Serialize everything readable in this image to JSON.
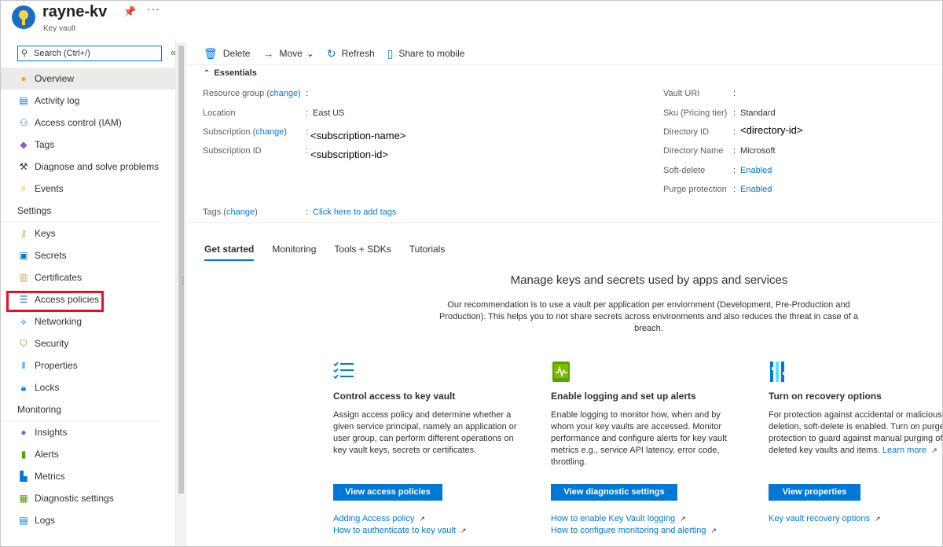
{
  "header": {
    "title": "rayne-kv",
    "subtitle": "Key vault"
  },
  "sidebar": {
    "search_placeholder": "Search (Ctrl+/)",
    "top_items": [
      {
        "label": "Overview",
        "icon": "overview-icon"
      },
      {
        "label": "Activity log",
        "icon": "activity-log-icon"
      },
      {
        "label": "Access control (IAM)",
        "icon": "iam-icon"
      },
      {
        "label": "Tags",
        "icon": "tag-icon"
      },
      {
        "label": "Diagnose and solve problems",
        "icon": "wrench-icon"
      },
      {
        "label": "Events",
        "icon": "lightning-icon"
      }
    ],
    "settings_label": "Settings",
    "settings_items": [
      {
        "label": "Keys",
        "icon": "key-icon"
      },
      {
        "label": "Secrets",
        "icon": "secret-icon"
      },
      {
        "label": "Certificates",
        "icon": "certificate-icon"
      },
      {
        "label": "Access policies",
        "icon": "access-policies-icon"
      },
      {
        "label": "Networking",
        "icon": "networking-icon"
      },
      {
        "label": "Security",
        "icon": "shield-icon"
      },
      {
        "label": "Properties",
        "icon": "properties-icon"
      },
      {
        "label": "Locks",
        "icon": "lock-icon"
      }
    ],
    "monitoring_label": "Monitoring",
    "monitoring_items": [
      {
        "label": "Insights",
        "icon": "insights-icon"
      },
      {
        "label": "Alerts",
        "icon": "alerts-icon"
      },
      {
        "label": "Metrics",
        "icon": "metrics-icon"
      },
      {
        "label": "Diagnostic settings",
        "icon": "diagnostic-settings-icon"
      },
      {
        "label": "Logs",
        "icon": "logs-icon"
      }
    ]
  },
  "toolbar": {
    "delete": "Delete",
    "move": "Move",
    "refresh": "Refresh",
    "share": "Share to mobile"
  },
  "essentials": {
    "heading": "Essentials",
    "change": "change",
    "left": {
      "resource_group_label": "Resource group",
      "resource_group_value": "",
      "location_label": "Location",
      "location_value": "East US",
      "subscription_label": "Subscription",
      "subscription_value": "<subscription-name>",
      "subscription_id_label": "Subscription ID",
      "subscription_id_value": "<subscription-id>"
    },
    "right": {
      "vault_uri_label": "Vault URI",
      "vault_uri_value": "",
      "sku_label": "Sku (Pricing tier)",
      "sku_value": "Standard",
      "directory_id_label": "Directory ID",
      "directory_id_value": "<directory-id>",
      "directory_name_label": "Directory Name",
      "directory_name_value": "Microsoft",
      "soft_delete_label": "Soft-delete",
      "soft_delete_value": "Enabled",
      "purge_label": "Purge protection",
      "purge_value": "Enabled"
    },
    "tags_label": "Tags",
    "tags_link": "Click here to add tags"
  },
  "tabs": [
    "Get started",
    "Monitoring",
    "Tools + SDKs",
    "Tutorials"
  ],
  "main": {
    "title": "Manage keys and secrets used by apps and services",
    "description": "Our recommendation is to use a vault per application per enviornment (Development, Pre-Production and Production). This helps you to not share secrets across environments and also reduces the threat in case of a breach."
  },
  "cards": [
    {
      "title": "Control access to key vault",
      "desc": "Assign access policy and determine whether a given service principal, namely an application or user group, can perform different operations on key vault keys, secrets or certificates.",
      "button": "View access policies",
      "link1": "Adding Access policy",
      "link2": "How to authenticate to key vault"
    },
    {
      "title": "Enable logging and set up alerts",
      "desc": "Enable logging to monitor how, when and by whom your key vaults are accessed. Monitor performance and configure alerts for key vault metrics e.g., service API latency, error code, throttling.",
      "button": "View diagnostic settings",
      "link1": "How to enable Key Vault logging",
      "link2": "How to configure monitoring and alerting"
    },
    {
      "title": "Turn on recovery options",
      "desc": "For protection against accidental or malicious deletion, soft-delete is enabled. Turn on purge protection to guard against manual purging of deleted key vaults and items.",
      "desc_link": "Learn more",
      "button": "View properties",
      "link1": "Key vault recovery options"
    }
  ],
  "colors": {
    "accent": "#0078d4",
    "highlight": "#e81123"
  }
}
